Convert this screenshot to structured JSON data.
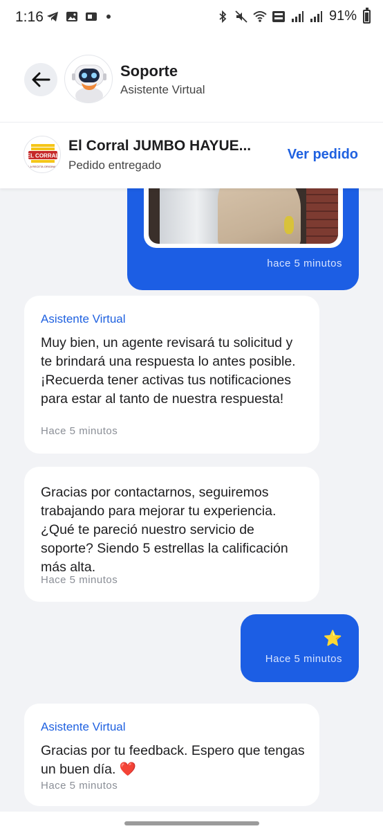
{
  "status_bar": {
    "time": "1:16",
    "battery": "91%"
  },
  "header": {
    "title": "Soporte",
    "subtitle": "Asistente Virtual"
  },
  "order": {
    "restaurant_name": "El Corral JUMBO HAYUE...",
    "status": "Pedido entregado",
    "action": "Ver pedido",
    "logo_text_top": "EL CORRAL",
    "logo_text_bottom": "LA RECETA ORIGINAL"
  },
  "messages": [
    {
      "direction": "outgoing",
      "type": "image",
      "time": "hace 5 minutos"
    },
    {
      "direction": "incoming",
      "sender": "Asistente Virtual",
      "text": "Muy bien, un agente revisará tu solicitud y te brindará una respuesta lo antes posible. ¡Recuerda tener activas tus notificaciones para estar al tanto de nuestra respuesta!",
      "time": "Hace 5 minutos"
    },
    {
      "direction": "incoming",
      "text": "Gracias por contactarnos, seguiremos trabajando para mejorar tu experiencia. ¿Qué te pareció nuestro servicio de soporte? Siendo 5 estrellas la calificación más alta.",
      "time": "Hace 5 minutos"
    },
    {
      "direction": "outgoing",
      "text": "⭐",
      "time": "Hace 5 minutos"
    },
    {
      "direction": "incoming",
      "sender": "Asistente Virtual",
      "text": "Gracias por tu feedback. Espero que tengas un buen día. ❤️",
      "time": "Hace 5 minutos"
    }
  ],
  "colors": {
    "accent": "#1f61e0",
    "outgoing_bubble": "#1c5ee4",
    "chat_background": "#f2f3f6"
  }
}
